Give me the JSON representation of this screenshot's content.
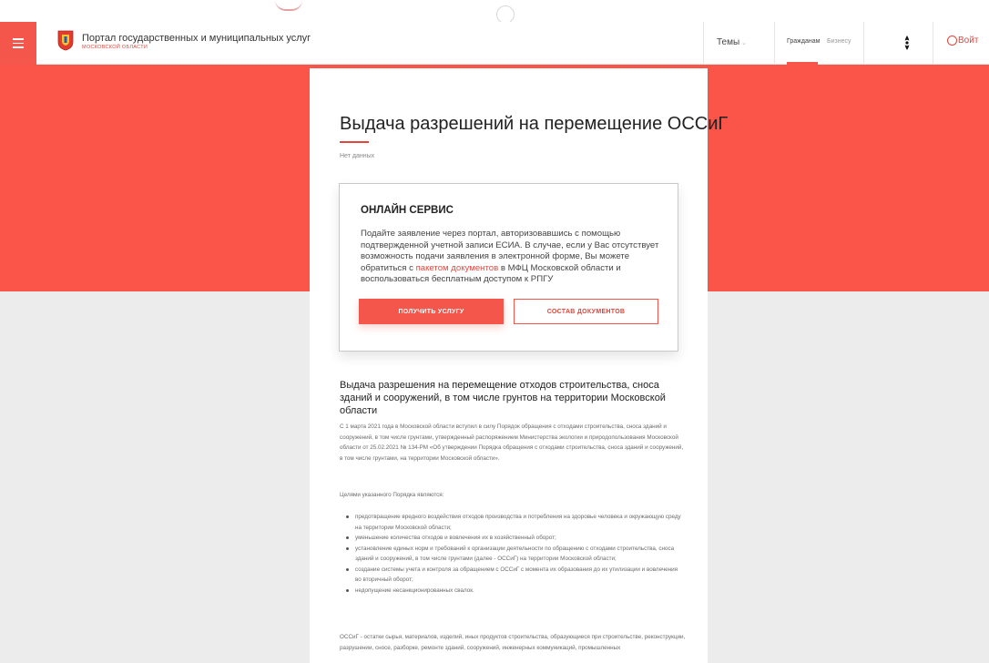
{
  "header": {
    "portal_title": "Портал государственных и муниципальных услуг",
    "portal_subtitle": "МОСКОВСКОЙ ОБЛАСТИ",
    "topics_label": "Темы",
    "segment_citizens": "Гражданам",
    "segment_business": "Бизнесу",
    "login_label": "Войт",
    "accent_color": "#f4564b"
  },
  "page": {
    "title": "Выдача разрешений на перемещение ОССиГ",
    "no_data": "Нет данных"
  },
  "service": {
    "heading": "ОНЛАЙН СЕРВИС",
    "text_before_link": "Подайте заявление через портал, авторизовавшись с помощью подтвержденной учетной записи ЕСИА. В случае, если у Вас отсутствует возможность подачи заявления в электронной форме, Вы можете обратиться с ",
    "link_text": "пакетом документов",
    "text_after_link": " в МФЦ Московской области и воспользоваться бесплатным доступом к РПГУ",
    "primary_button": "ПОЛУЧИТЬ УСЛУГУ",
    "secondary_button": "СОСТАВ ДОКУМЕНТОВ"
  },
  "content": {
    "section_heading": "Выдача разрешения на перемещение отходов строительства, сноса зданий и сооружений, в том числе грунтов на территории Московской области",
    "paragraph_1": "С 1 марта 2021 года в Московской области вступил в силу Порядок обращения с отходами строительства, сноса зданий и сооружений, в том числе грунтами, утвержденный распоряжением Министерства экологии и природопользования Московской области от 25.02.2021 № 134-РМ «Об утверждении Порядка обращения с отходами строительства, сноса зданий и сооружений, в том числе грунтами, на территории Московской области».",
    "paragraph_2": "Целями указанного Порядка являются:",
    "bullets": [
      "предотвращение вредного воздействия отходов производства и потребления на здоровье человека и окружающую среду на территории Московской области;",
      "уменьшение количества отходов и вовлечения их в хозяйственный оборот;",
      "установление единых норм и требований к организации деятельности по обращению с отходами строительства, сноса зданий и сооружений, в том числе грунтами (далее - ОССиГ) на территории Московской области;",
      "создание системы учета и контроля за обращением с ОССиГ с момента их образования до их утилизации и вовлечения во вторичный оборот;",
      "недопущение несанкционированных свалок."
    ],
    "paragraph_3": "ОССиГ - остатки сырья, материалов, изделий, иных продуктов строительства, образующиеся при строительстве, реконструкции, разрушении, сносе, разборке, ремонте зданий, сооружений, инженерных коммуникаций, промышленных"
  }
}
